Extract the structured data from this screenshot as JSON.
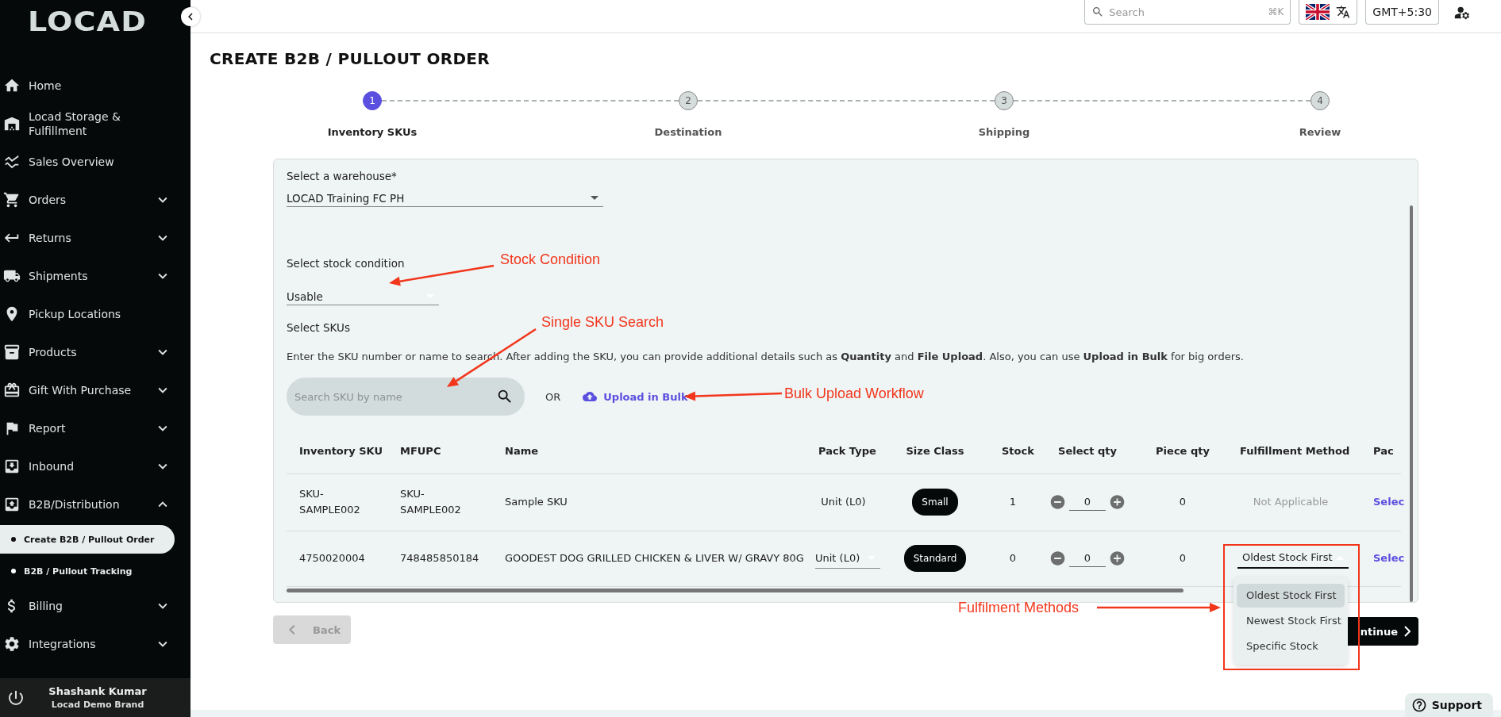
{
  "sidebar": {
    "logo": "LOCAD",
    "items": [
      {
        "label": "Home",
        "kind": "link"
      },
      {
        "label": "Locad Storage & Fulfillment",
        "kind": "link"
      },
      {
        "label": "Sales Overview",
        "kind": "link"
      },
      {
        "label": "Orders",
        "kind": "group",
        "expanded": false
      },
      {
        "label": "Returns",
        "kind": "group",
        "expanded": false
      },
      {
        "label": "Shipments",
        "kind": "group",
        "expanded": false
      },
      {
        "label": "Pickup Locations",
        "kind": "link"
      },
      {
        "label": "Products",
        "kind": "group",
        "expanded": false
      },
      {
        "label": "Gift With Purchase",
        "kind": "group",
        "expanded": false
      },
      {
        "label": "Report",
        "kind": "group",
        "expanded": false
      },
      {
        "label": "Inbound",
        "kind": "group",
        "expanded": false
      },
      {
        "label": "B2B/Distribution",
        "kind": "group",
        "expanded": true,
        "children": [
          {
            "label": "Create B2B / Pullout Order",
            "selected": true
          },
          {
            "label": "B2B / Pullout Tracking",
            "selected": false
          }
        ]
      },
      {
        "label": "Billing",
        "kind": "group",
        "expanded": false
      },
      {
        "label": "Integrations",
        "kind": "group",
        "expanded": false
      }
    ],
    "user": {
      "name": "Shashank Kumar",
      "brand": "Locad Demo Brand"
    }
  },
  "topbar": {
    "search": {
      "placeholder": "Search",
      "shortcut": "⌘K"
    },
    "timezone": "GMT+5:30"
  },
  "page": {
    "title": "CREATE B2B / PULLOUT ORDER"
  },
  "steps": [
    {
      "number": "1",
      "label": "Inventory SKUs",
      "selected": true
    },
    {
      "number": "2",
      "label": "Destination",
      "selected": false
    },
    {
      "number": "3",
      "label": "Shipping",
      "selected": false
    },
    {
      "number": "4",
      "label": "Review",
      "selected": false
    }
  ],
  "form": {
    "warehouse": {
      "label": "Select a warehouse*",
      "value": "LOCAD Training FC PH"
    },
    "stock_condition": {
      "label": "Select stock condition",
      "value": "Usable"
    },
    "skus": {
      "label": "Select SKUs",
      "description": "Enter the SKU number or name to search. After adding the SKU, you can provide additional details such as **Quantity** and **File Upload**. Also, you can use **Upload in Bulk** for big orders.",
      "search_placeholder": "Search SKU by name",
      "or": "OR",
      "bulk_upload": "Upload in Bulk"
    }
  },
  "table": {
    "columns": [
      "Inventory SKU",
      "MFUPC",
      "Name",
      "Pack Type",
      "Size Class",
      "Stock",
      "Select qty",
      "Piece qty",
      "Fulfillment Method",
      "Pac"
    ],
    "rows": [
      {
        "sku": "SKU-SAMPLE002",
        "mfupc": "SKU-SAMPLE002",
        "name": "Sample SKU",
        "pack_type": {
          "kind": "text",
          "value": "Unit (L0)"
        },
        "size_class": "Small",
        "stock": "1",
        "qty": "0",
        "piece_qty": "0",
        "fulfillment": {
          "kind": "disabled",
          "value": "Not Applicable"
        },
        "packaging": "Selec"
      },
      {
        "sku": "4750020004",
        "mfupc": "748485850184",
        "name": "GOODEST DOG GRILLED CHICKEN & LIVER W/ GRAVY 80G",
        "pack_type": {
          "kind": "select",
          "value": "Unit (L0)"
        },
        "size_class": "Standard",
        "stock": "0",
        "qty": "0",
        "piece_qty": "0",
        "fulfillment": {
          "kind": "select",
          "value": "Oldest Stock First",
          "expanded": true,
          "options": [
            {
              "label": "Oldest Stock First",
              "selected": true
            },
            {
              "label": "Newest Stock First",
              "selected": false
            },
            {
              "label": "Specific Stock",
              "selected": false
            }
          ]
        },
        "packaging": "Selec"
      }
    ]
  },
  "buttons": {
    "back": {
      "label": "Back",
      "disabled": true
    },
    "continue": {
      "label": "ntinue"
    }
  },
  "support": "Support",
  "annotations": [
    {
      "text": "Stock Condition"
    },
    {
      "text": "Single SKU Search"
    },
    {
      "text": "Bulk Upload Workflow"
    },
    {
      "text": "Fulfilment Methods"
    }
  ]
}
